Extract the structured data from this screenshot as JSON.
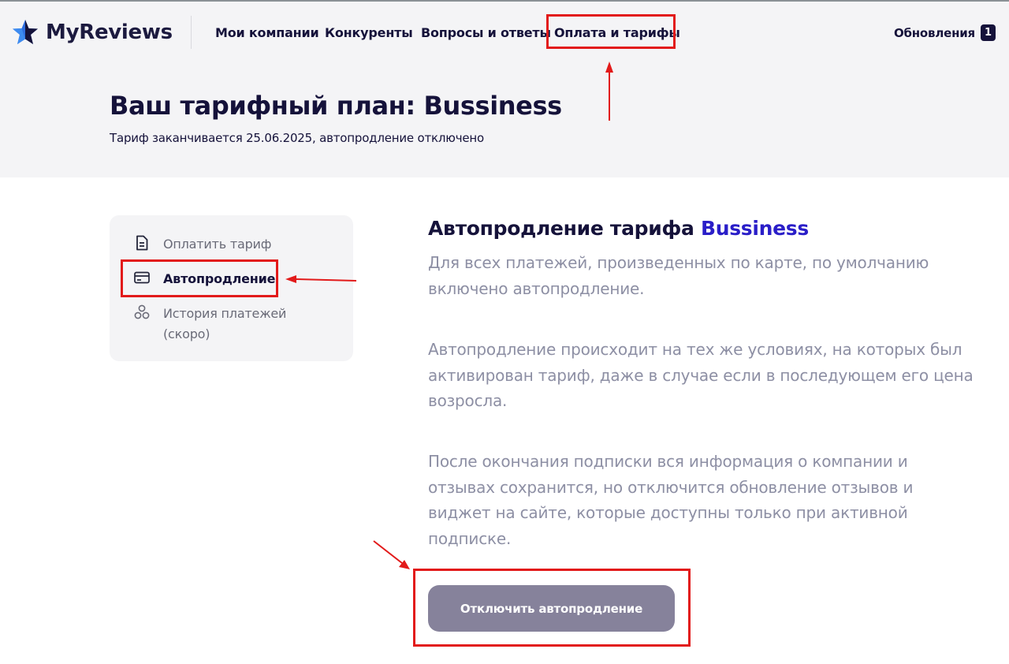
{
  "brand": {
    "name": "MyReviews",
    "colors": {
      "star_blue": "#2f6fe0",
      "star_navy": "#15123a"
    }
  },
  "nav": {
    "items": [
      {
        "label": "Мои компании"
      },
      {
        "label": "Конкуренты"
      },
      {
        "label": "Вопросы и ответы"
      },
      {
        "label": "Оплата и тарифы"
      }
    ],
    "updates_label": "Обновления",
    "updates_count": "1"
  },
  "plan": {
    "title": "Ваш тарифный план: Bussiness",
    "subtitle": "Тариф заканчивается 25.06.2025, автопродление отключено"
  },
  "sidebar": {
    "items": [
      {
        "label": "Оплатить тариф",
        "icon": "document-icon"
      },
      {
        "label": "Автопродление",
        "icon": "card-icon",
        "active": true
      },
      {
        "label": "История платежей (скоро)",
        "icon": "circles-icon"
      }
    ]
  },
  "content": {
    "title_prefix": "Автопродление тарифа",
    "title_plan": "Bussiness",
    "paragraphs": [
      "Для всех платежей, произведенных по карте, по умолчанию включено автопродление.",
      "Автопродление происходит на тех же условиях, на которых был активирован тариф, даже в случае если в последующем его цена возросла.",
      "После окончания подписки вся информация о компании и отзывах сохранится, но отключится обновление отзывов и виджет на сайте, которые доступны только при активной подписке."
    ],
    "button_label": "Отключить автопродление"
  },
  "annotation_color": "#e21a1a"
}
